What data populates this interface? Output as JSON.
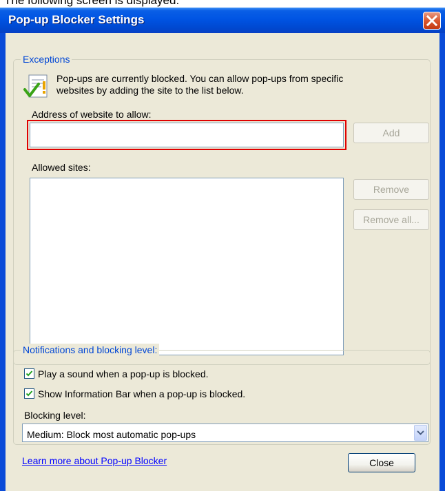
{
  "page_caption": "The following screen is displayed:",
  "window": {
    "title": "Pop-up Blocker Settings"
  },
  "exceptions": {
    "legend": "Exceptions",
    "info_text_line1": "Pop-ups are currently blocked.  You can allow pop-ups from specific",
    "info_text_line2": "websites by adding the site to the list below.",
    "address_label": "Address of website to allow:",
    "address_value": "",
    "add_button": "Add",
    "allowed_label": "Allowed sites:",
    "allowed_sites": [],
    "remove_button": "Remove",
    "remove_all_button": "Remove all..."
  },
  "notifications": {
    "legend": "Notifications and blocking level:",
    "play_sound": {
      "label": "Play a sound when a pop-up is blocked.",
      "checked": true
    },
    "show_info_bar": {
      "label": "Show Information Bar when a pop-up is blocked.",
      "checked": true
    },
    "blocking_level_label": "Blocking level:",
    "blocking_level_value": "Medium: Block most automatic pop-ups"
  },
  "footer": {
    "learn_more_link": "Learn more about Pop-up Blocker",
    "close_button": "Close"
  },
  "colors": {
    "titlebar": "#0054e3",
    "dialog_bg": "#ece9d8",
    "group_legend": "#0046d5",
    "highlight_border": "#e00000",
    "link": "#0000ff"
  }
}
